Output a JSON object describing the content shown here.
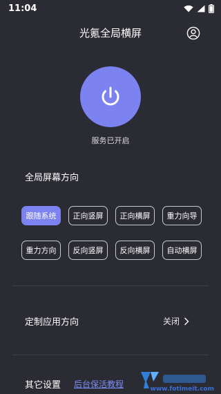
{
  "status_bar": {
    "time": "11:04"
  },
  "header": {
    "title": "光氪全局横屏"
  },
  "power": {
    "status": "服务已开启"
  },
  "orientation": {
    "title": "全局屏幕方向",
    "options": [
      "跟随系统",
      "正向竖屏",
      "正向横屏",
      "重力向导",
      "重力方向",
      "反向竖屏",
      "反向横屏",
      "自动横屏"
    ],
    "selected": "跟随系统"
  },
  "custom_app": {
    "label": "定制应用方向",
    "value": "关闭"
  },
  "other": {
    "label": "其它设置",
    "link": "后台保活教程"
  },
  "watermark": {
    "url": "www.fotimeit.com"
  },
  "colors": {
    "background": "#2b2b33",
    "accent": "#7c82f0",
    "link": "#7c8cf5"
  }
}
